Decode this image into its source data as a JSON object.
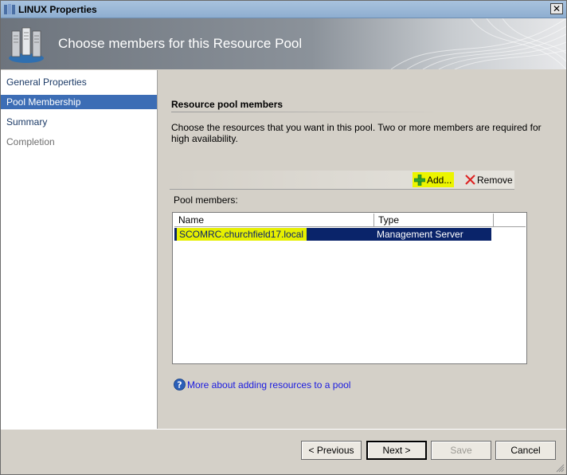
{
  "window": {
    "title": "LINUX Properties"
  },
  "banner": {
    "heading": "Choose members for this Resource Pool"
  },
  "nav": {
    "items": [
      {
        "label": "General Properties",
        "state": "normal"
      },
      {
        "label": "Pool Membership",
        "state": "selected"
      },
      {
        "label": "Summary",
        "state": "normal"
      },
      {
        "label": "Completion",
        "state": "disabled"
      }
    ]
  },
  "content": {
    "section_title": "Resource pool members",
    "description": "Choose the resources that you want in this pool. Two or more members are required for high availability.",
    "toolbar": {
      "add_label": "Add...",
      "remove_label": "Remove"
    },
    "pool_members_label": "Pool members:",
    "table": {
      "columns": [
        "Name",
        "Type"
      ],
      "rows": [
        {
          "name": "SCOMRC.churchfield17.local",
          "type": "Management Server"
        }
      ]
    },
    "help_link": "More about adding resources to a pool"
  },
  "footer": {
    "previous_label": "< Previous",
    "next_label": "Next >",
    "save_label": "Save",
    "cancel_label": "Cancel"
  },
  "colors": {
    "selection": "#0a246a",
    "nav_selected": "#3c6db5",
    "highlight": "#e6ef00",
    "link": "#1a1ae0"
  }
}
